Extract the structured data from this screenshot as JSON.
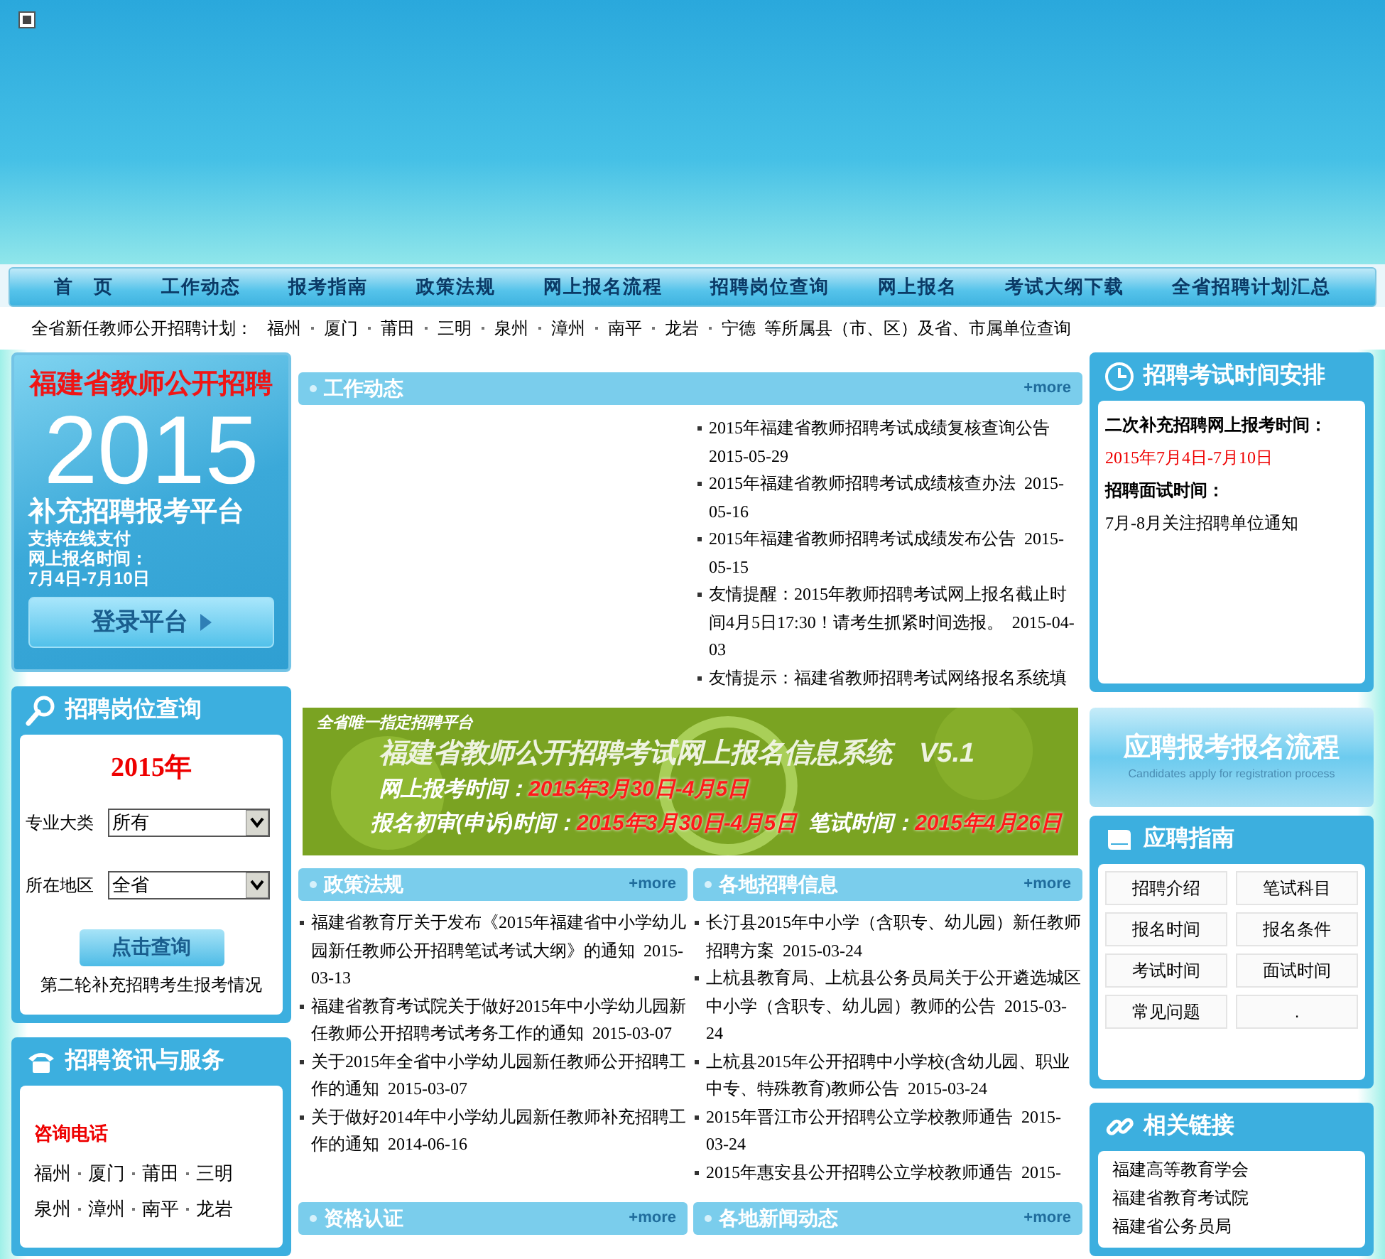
{
  "nav": [
    {
      "label": "首　页"
    },
    {
      "label": "工作动态"
    },
    {
      "label": "报考指南"
    },
    {
      "label": "政策法规"
    },
    {
      "label": "网上报名流程"
    },
    {
      "label": "招聘岗位查询"
    },
    {
      "label": "网上报名"
    },
    {
      "label": "考试大纲下载"
    },
    {
      "label": "全省招聘计划汇总"
    }
  ],
  "plan": {
    "label": "全省新任教师公开招聘计划：",
    "cities": [
      "福州",
      "厦门",
      "莆田",
      "三明",
      "泉州",
      "漳州",
      "南平",
      "龙岩",
      "宁德"
    ],
    "suffix": "等所属县（市、区）及省、市属单位查询"
  },
  "promo": {
    "title": "福建省教师公开招聘",
    "year": "2015",
    "subtitle": "补充招聘报考平台",
    "lines": [
      "支持在线支付",
      "网上报名时间：",
      "7月4日-7月10日"
    ],
    "button": "登录平台"
  },
  "job_search": {
    "title": "招聘岗位查询",
    "year": "2015年",
    "fields": [
      {
        "label": "专业大类",
        "value": "所有"
      },
      {
        "label": "所在地区",
        "value": "全省"
      }
    ],
    "button": "点击查询",
    "link": "第二轮补充招聘考生报考情况"
  },
  "services": {
    "title": "招聘资讯与服务",
    "phone_label": "咨询电话",
    "city_rows": [
      [
        "福州",
        "厦门",
        "莆田",
        "三明"
      ],
      [
        "泉州",
        "漳州",
        "南平",
        "龙岩"
      ]
    ]
  },
  "work_news": {
    "title": "工作动态",
    "more": "+more",
    "items": [
      {
        "title": "2015年福建省教师招聘考试成绩复核查询公告",
        "date": "2015-05-29"
      },
      {
        "title": "2015年福建省教师招聘考试成绩核查办法",
        "date": "2015-05-16"
      },
      {
        "title": "2015年福建省教师招聘考试成绩发布公告",
        "date": "2015-05-15"
      },
      {
        "title": "友情提醒：2015年教师招聘考试网上报名截止时间4月5日17:30！请考生抓紧时间选报。",
        "date": "2015-04-03"
      },
      {
        "title": "友情提示：福建省教师招聘考试网络报名系统填"
      }
    ]
  },
  "system_banner": {
    "tag": "全省唯一指定招聘平台",
    "title": "福建省教师公开招聘考试网上报名信息系统　V5.1",
    "rows": [
      [
        {
          "label": "网上报考时间：",
          "value": "2015年3月30日-4月5日"
        }
      ],
      [
        {
          "label": "报名初审(申诉)时间：",
          "value": "2015年3月30日-4月5日"
        },
        {
          "label": "笔试时间：",
          "value": "2015年4月26日"
        }
      ]
    ]
  },
  "sections": [
    {
      "title": "政策法规",
      "more": "+more",
      "items": [
        {
          "title": "福建省教育厅关于发布《2015年福建省中小学幼儿园新任教师公开招聘笔试考试大纲》的通知",
          "date": "2015-03-13"
        },
        {
          "title": "福建省教育考试院关于做好2015年中小学幼儿园新任教师公开招聘考试考务工作的通知",
          "date": "2015-03-07"
        },
        {
          "title": "关于2015年全省中小学幼儿园新任教师公开招聘工作的通知",
          "date": "2015-03-07"
        },
        {
          "title": "关于做好2014年中小学幼儿园新任教师补充招聘工作的通知",
          "date": "2014-06-16"
        }
      ]
    },
    {
      "title": "各地招聘信息",
      "more": "+more",
      "items": [
        {
          "title": "长汀县2015年中小学（含职专、幼儿园）新任教师招聘方案",
          "date": "2015-03-24"
        },
        {
          "title": "上杭县教育局、上杭县公务员局关于公开遴选城区中小学（含职专、幼儿园）教师的公告",
          "date": "2015-03-24"
        },
        {
          "title": "上杭县2015年公开招聘中小学校(含幼儿园、职业中专、特殊教育)教师公告",
          "date": "2015-03-24"
        },
        {
          "title": "2015年晋江市公开招聘公立学校教师通告",
          "date": "2015-03-24"
        },
        {
          "title": "2015年惠安县公开招聘公立学校教师通告",
          "date": "2015-"
        }
      ]
    },
    {
      "title": "资格认证",
      "more": "+more"
    },
    {
      "title": "各地新闻动态",
      "more": "+more"
    }
  ],
  "schedule": {
    "title": "招聘考试时间安排",
    "lines": [
      {
        "kind": "heading",
        "text": "二次补充招聘网上报考时间："
      },
      {
        "kind": "highlight",
        "text": "2015年7月4日-7月10日"
      },
      {
        "kind": "heading",
        "text": "招聘面试时间："
      },
      {
        "kind": "text",
        "text": "7月-8月关注招聘单位通知"
      }
    ]
  },
  "process": {
    "title": "应聘报考报名流程",
    "subtitle": "Candidates apply for registration process"
  },
  "guide": {
    "title": "应聘指南",
    "items": [
      "招聘介绍",
      "笔试科目",
      "报名时间",
      "报名条件",
      "考试时间",
      "面试时间",
      "常见问题",
      "."
    ]
  },
  "links": {
    "title": "相关链接",
    "items": [
      "福建高等教育学会",
      "福建省教育考试院",
      "福建省公务员局"
    ]
  }
}
